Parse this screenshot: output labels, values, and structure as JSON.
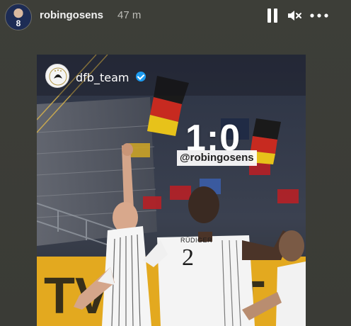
{
  "story": {
    "username": "robingosens",
    "timestamp": "47 m",
    "avatar_number": "8",
    "controls": {
      "pause_icon": "pause-icon",
      "mute_icon": "speaker-muted-icon",
      "more_icon": "more-dots-icon"
    }
  },
  "post": {
    "account": "dfb_team",
    "verified": true,
    "score": "1:0",
    "mention": "@robingosens",
    "jersey_name": "RÜDIGER",
    "jersey_number": "2"
  },
  "colors": {
    "background": "#3a3b36",
    "verified_badge": "#1d9bf0",
    "mention_bg": "#ffffff"
  }
}
